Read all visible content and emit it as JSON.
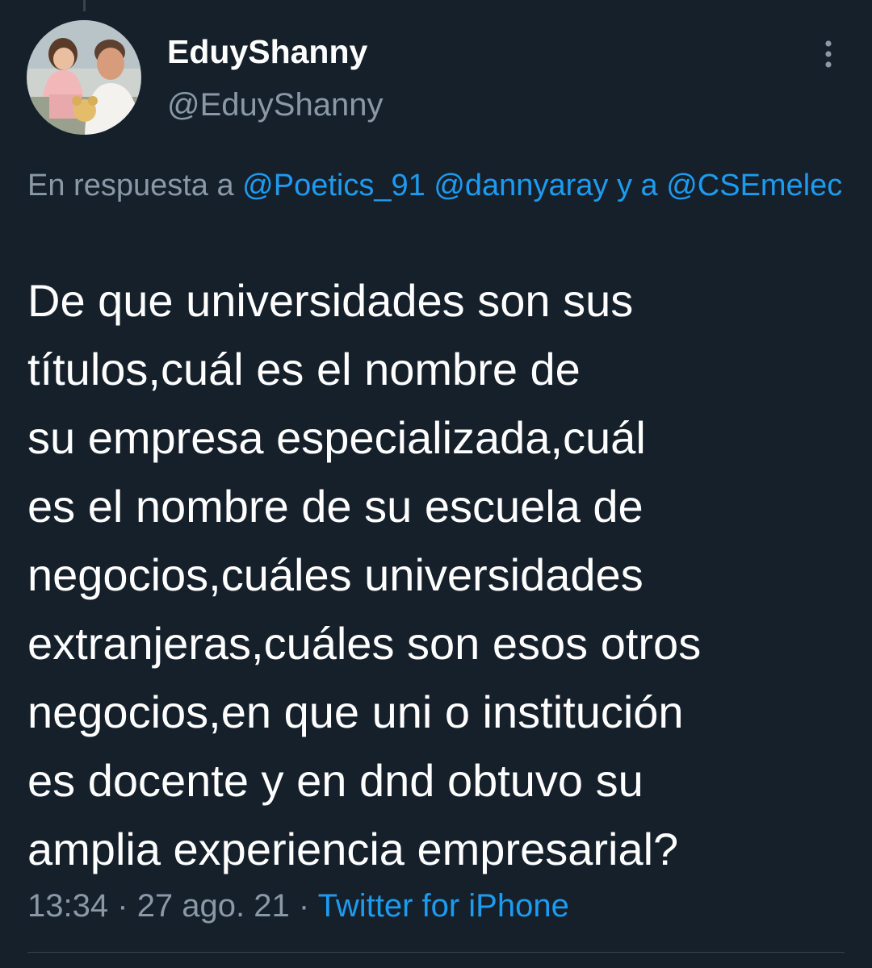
{
  "tweet": {
    "display_name": "EduyShanny",
    "handle": "@EduyShanny",
    "reply_context": {
      "prefix": "En respuesta a",
      "mentions": [
        "@Poetics_91",
        "@dannyaray"
      ],
      "conjunction": "y a",
      "last_mention": "@CSEmelec"
    },
    "text_lines": [
      "De que universidades son sus",
      "títulos,cuál es el nombre de",
      "su empresa especializada,cuál",
      "es el nombre de su escuela de",
      "negocios,cuáles universidades",
      "extranjeras,cuáles son esos otros",
      "negocios,en que uni o institución",
      "es docente y en dnd obtuvo su",
      "amplia experiencia empresarial?"
    ],
    "time": "13:34",
    "separator": "·",
    "date": "27 ago. 21",
    "source": "Twitter for iPhone"
  },
  "colors": {
    "background": "#15202b",
    "text_primary": "#ffffff",
    "text_secondary": "#8b98a5",
    "accent": "#1d9bf0"
  },
  "icons": {
    "more": "more-vertical-icon",
    "avatar": "profile-photo"
  }
}
